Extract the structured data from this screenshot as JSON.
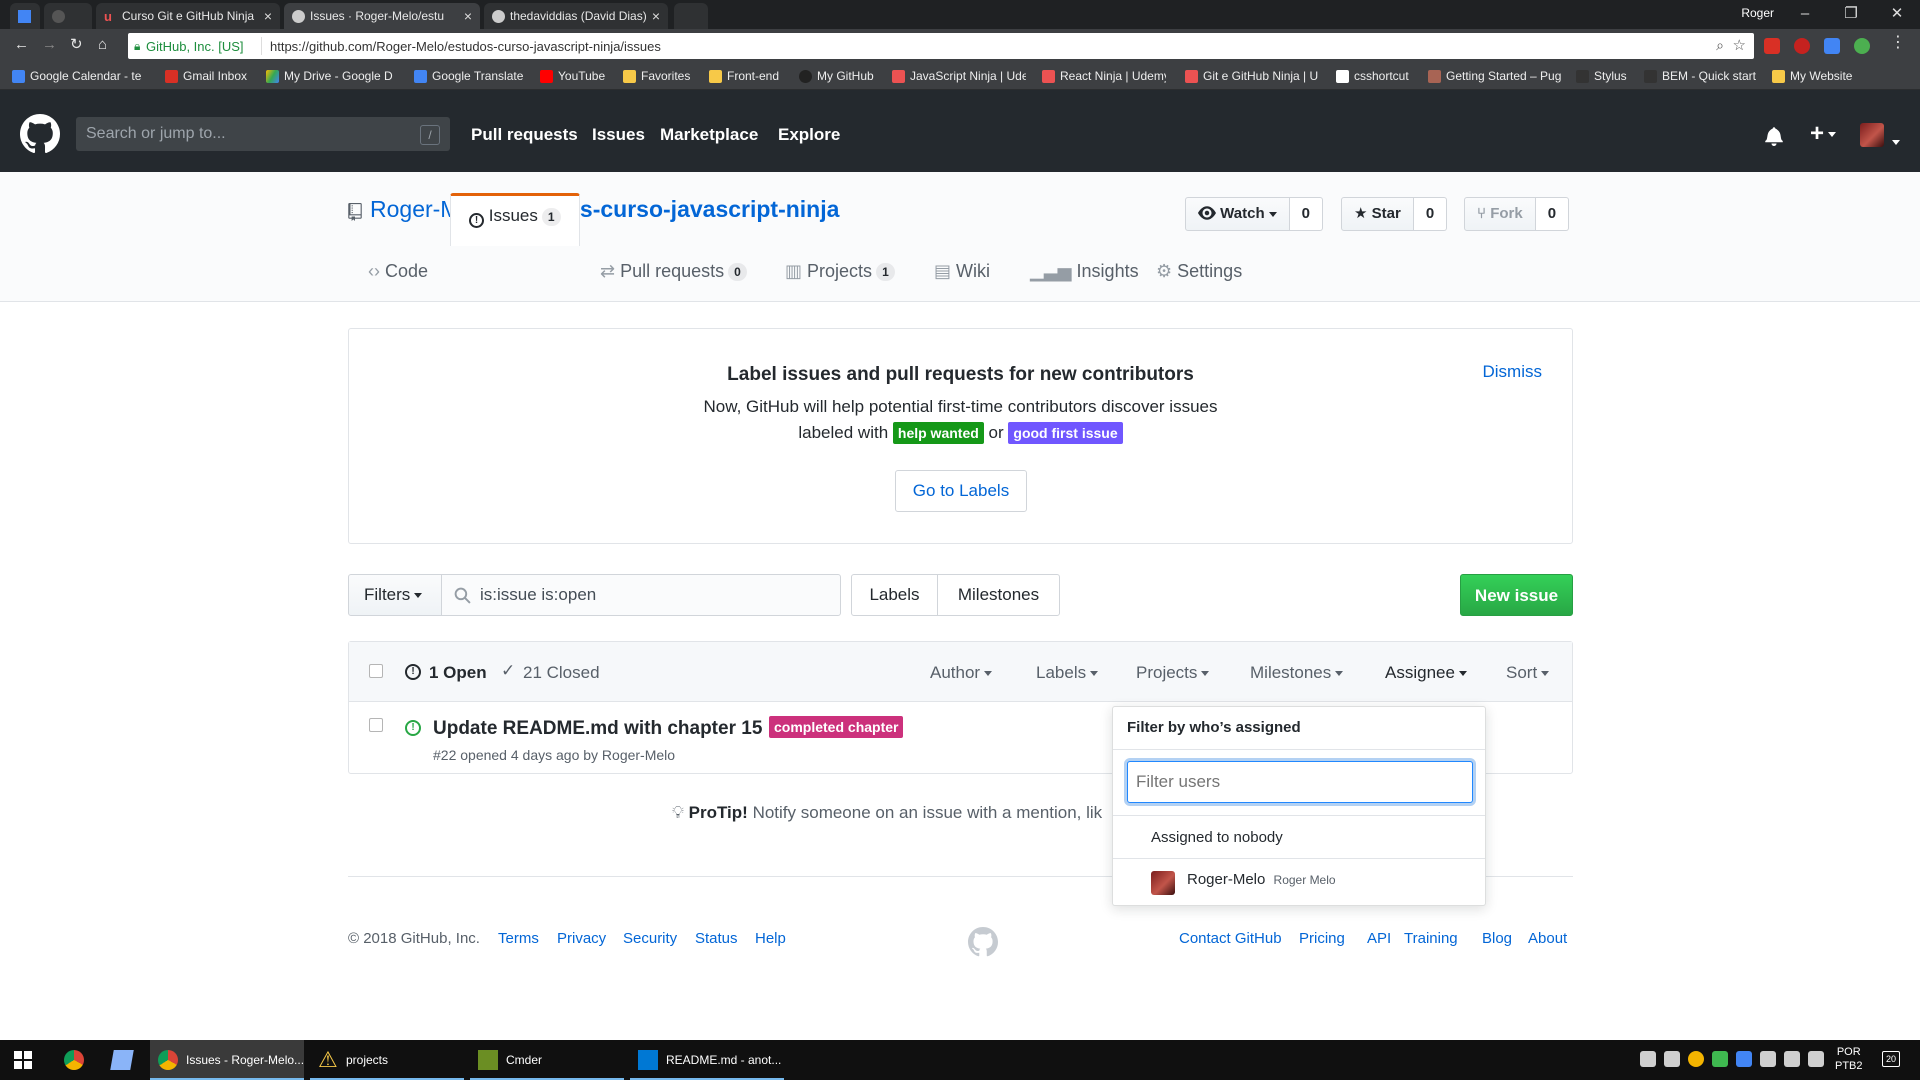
{
  "browser": {
    "tabs": [
      {
        "label": "",
        "favicon": "calendar-icon"
      },
      {
        "label": "",
        "favicon": "github-icon"
      },
      {
        "label": "Curso Git e GitHub Ninja",
        "favicon": "udemy-icon"
      },
      {
        "label": "Issues · Roger-Melo/estu",
        "favicon": "github-icon",
        "active": true
      },
      {
        "label": "thedaviddias (David Dias)",
        "favicon": "github-icon"
      }
    ],
    "user": "Roger",
    "security_label": "GitHub, Inc. [US]",
    "url": "https://github.com/Roger-Melo/estudos-curso-javascript-ninja/issues",
    "bookmarks": [
      "Google Calendar - te",
      "Gmail Inbox",
      "My Drive - Google D",
      "Google Translate",
      "YouTube",
      "Favorites",
      "Front-end",
      "My GitHub",
      "JavaScript Ninja | Ude",
      "React Ninja | Udemy",
      "Git e GitHub Ninja | U",
      "csshortcut",
      "Getting Started – Pug",
      "Stylus",
      "BEM - Quick start",
      "My Website"
    ]
  },
  "header": {
    "search_placeholder": "Search or jump to...",
    "search_shortcut": "/",
    "nav": [
      "Pull requests",
      "Issues",
      "Marketplace",
      "Explore"
    ]
  },
  "repo": {
    "owner": "Roger-Melo",
    "separator": "/",
    "name": "estudos-curso-javascript-ninja",
    "watch_label": "Watch",
    "watch_count": "0",
    "star_label": "Star",
    "star_count": "0",
    "fork_label": "Fork",
    "fork_count": "0",
    "tabs": {
      "code": "Code",
      "issues": "Issues",
      "issues_count": "1",
      "pulls": "Pull requests",
      "pulls_count": "0",
      "projects": "Projects",
      "projects_count": "1",
      "wiki": "Wiki",
      "insights": "Insights",
      "settings": "Settings"
    }
  },
  "banner": {
    "title": "Label issues and pull requests for new contributors",
    "line1": "Now, GitHub will help potential first-time contributors discover issues",
    "line2_prefix": "labeled with",
    "label_help": "help wanted",
    "label_help_color": "#159818",
    "or": "or",
    "label_good": "good first issue",
    "label_good_color": "#7057ff",
    "dismiss": "Dismiss",
    "button": "Go to Labels"
  },
  "filterbar": {
    "filters_label": "Filters",
    "query": "is:issue is:open",
    "labels_label": "Labels",
    "milestones_label": "Milestones",
    "new_issue_label": "New issue"
  },
  "issues": {
    "open_label": "1 Open",
    "closed_label": "21 Closed",
    "selectors": [
      "Author",
      "Labels",
      "Projects",
      "Milestones",
      "Assignee",
      "Sort"
    ],
    "items": [
      {
        "title": "Update README.md with chapter 15",
        "label": "completed chapter",
        "label_color": "#cc317c",
        "meta": "#22 opened 4 days ago by Roger-Melo"
      }
    ]
  },
  "protip": {
    "bold": "ProTip!",
    "text": "Notify someone on an issue with a mention, lik"
  },
  "assignee_dropdown": {
    "title": "Filter by who’s assigned",
    "filter_placeholder": "Filter users",
    "nobody": "Assigned to nobody",
    "user_login": "Roger-Melo",
    "user_name": "Roger Melo"
  },
  "footer": {
    "copyright": "© 2018 GitHub, Inc.",
    "left_links": [
      "Terms",
      "Privacy",
      "Security",
      "Status",
      "Help"
    ],
    "right_links": [
      "Contact GitHub",
      "Pricing",
      "API",
      "Training",
      "Blog",
      "About"
    ]
  },
  "taskbar": {
    "apps": [
      "Issues - Roger-Melo...",
      "projects",
      "Cmder",
      "README.md - anot..."
    ],
    "lang_top": "POR",
    "lang_bottom": "PTB2",
    "notifications": "20"
  },
  "colors": {
    "header_bg": "#24292e",
    "link": "#0366d6",
    "green": "#28a745",
    "selected_tab_accent": "#e36209"
  }
}
